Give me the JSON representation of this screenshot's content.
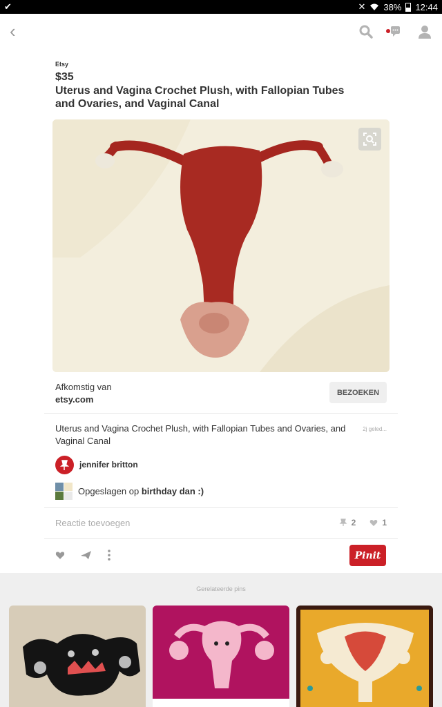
{
  "status_bar": {
    "time": "12:44",
    "battery": "38%"
  },
  "pin": {
    "source_small": "Etsy",
    "price": "$35",
    "title": "Uterus and Vagina Crochet Plush, with Fallopian Tubes and Ovaries, and Vaginal Canal",
    "from_label": "Afkomstig van",
    "from_domain": "etsy.com",
    "visit_label": "BEZOEKEN",
    "description": "Uterus and Vagina Crochet Plush, with Fallopian Tubes and Ovaries, and Vaginal Canal",
    "time_ago": "2j geled...",
    "pinner_name": "jennifer britton",
    "saved_prefix": "Opgeslagen op",
    "board_name": "birthday dan :)",
    "comment_placeholder": "Reactie toevoegen",
    "repin_count": "2",
    "like_count": "1",
    "pinit_label": "Pinit"
  },
  "related": {
    "label": "Gerelateerde pins"
  },
  "colors": {
    "accent": "#cb2027"
  }
}
